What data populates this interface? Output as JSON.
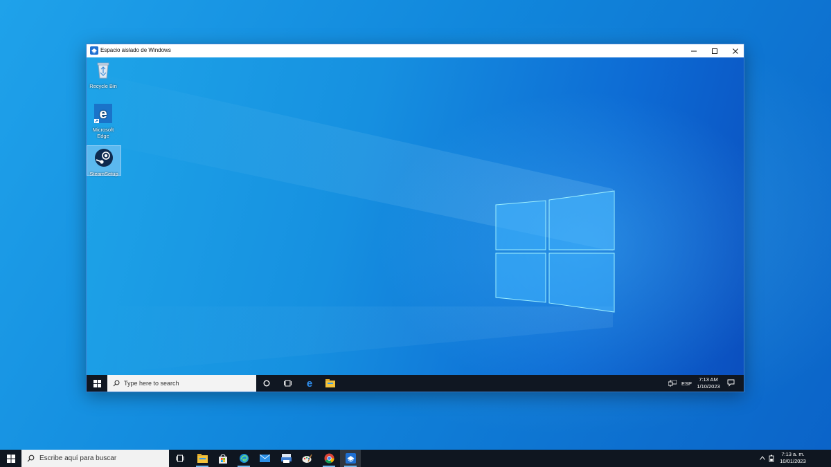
{
  "sandbox_window": {
    "title": "Espacio aislado de Windows",
    "controls": {
      "minimize": "minimize",
      "maximize": "maximize",
      "close": "close"
    }
  },
  "sandbox_desktop": {
    "icons": [
      {
        "label": "Recycle Bin",
        "icon": "recycle-bin-icon"
      },
      {
        "label": "Microsoft Edge",
        "icon": "edge-icon"
      },
      {
        "label": "SteamSetup",
        "icon": "steam-icon",
        "selected": true
      }
    ]
  },
  "sandbox_taskbar": {
    "search_placeholder": "Type here to search",
    "pinned": [
      "cortana-icon",
      "task-view-icon",
      "edge-icon",
      "file-explorer-icon"
    ],
    "tray": {
      "network": "network-icon",
      "language": "ESP",
      "time": "7:13 AM",
      "date": "1/10/2023",
      "notifications": "notification-icon"
    }
  },
  "host_taskbar": {
    "search_placeholder": "Escribe aquí para buscar",
    "apps": [
      "task-view-icon",
      "file-explorer-icon",
      "microsoft-store-icon",
      "edge-icon",
      "mail-icon",
      "scanner-icon",
      "paint-icon",
      "chrome-icon",
      "windows-sandbox-icon"
    ],
    "active_app": "windows-sandbox-icon",
    "tray": {
      "time": "7:13 a. m.",
      "date": "10/01/2023"
    }
  },
  "colors": {
    "desktop_blue": "#1187dc",
    "taskbar": "#0f1620",
    "accent": "#76b9ed"
  }
}
